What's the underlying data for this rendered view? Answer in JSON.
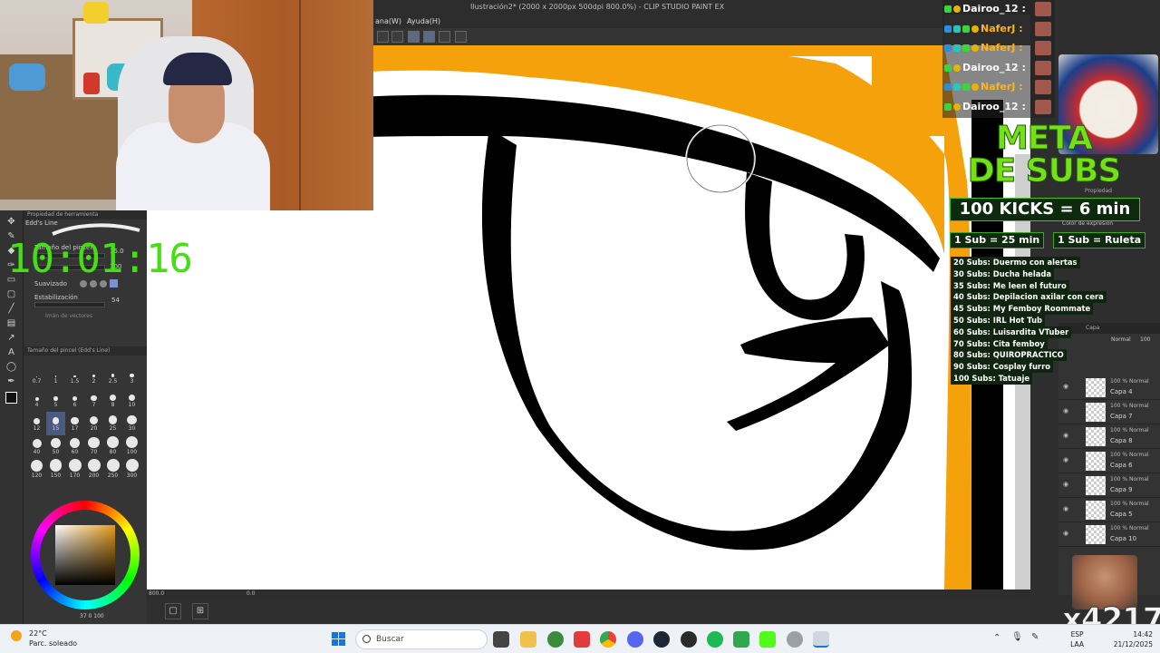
{
  "window": {
    "title": "Ilustración2* (2000 x 2000px 500dpi 800.0%) - CLIP STUDIO PAINT EX",
    "menu": [
      "ana(W)",
      "Ayuda(H)"
    ]
  },
  "stream": {
    "timer": "10:01:16",
    "chat": [
      {
        "user": "Dairoo_12 :",
        "color": "#ffffff"
      },
      {
        "user": "NaferJ :",
        "color": "#ffb31a"
      },
      {
        "user": "NaferJ :",
        "color": "#ffb31a"
      },
      {
        "user": "Dairoo_12 :",
        "color": "#ffffff"
      },
      {
        "user": "NaferJ :",
        "color": "#ffb31a"
      },
      {
        "user": "Dairoo_12 :",
        "color": "#ffffff"
      }
    ],
    "goal": {
      "title_line1": "META",
      "title_line2": "DE SUBS",
      "kicks": "100 KICKS = 6 min",
      "chip1": "1 Sub = 25 min",
      "chip2": "1 Sub = Ruleta",
      "items": [
        "20 Subs: Duermo con alertas",
        "30 Subs: Ducha helada",
        "35 Subs: Me leen el futuro",
        "40 Subs: Depilacion axilar con cera",
        "45 Subs: My Femboy Roommate",
        "50 Subs: IRL Hot Tub",
        "60 Subs: Luisardita VTuber",
        "70 Subs: Cita femboy",
        "80 Subs: QUIROPRACTICO",
        "90 Subs: Cosplay furro",
        "100 Subs: Tatuaje"
      ]
    },
    "bits": "x4217"
  },
  "tool_panel": {
    "brush_name": "Edd's Line",
    "size_label": "Tamaño del pincel",
    "size_value": "15.0",
    "opacity_value": "100",
    "smooth_label": "Suavizado",
    "stab_label": "Estabilización",
    "stab_value": "54",
    "vector_label": "Imán de vectores",
    "size_header": "Tamaño del pincel (Edd's Line)",
    "sizes": [
      "0.7",
      "1",
      "1.5",
      "2",
      "2.5",
      "3",
      "4",
      "5",
      "6",
      "7",
      "8",
      "10",
      "12",
      "15",
      "17",
      "20",
      "25",
      "30",
      "40",
      "50",
      "60",
      "70",
      "80",
      "100",
      "120",
      "150",
      "170",
      "200",
      "250",
      "300"
    ],
    "color_values": "37 0 100"
  },
  "canvas": {
    "zoom": "800.0",
    "rotation": "0.0"
  },
  "layers": {
    "header": "Capa",
    "opacity": "100",
    "mode_label": "Normal",
    "rows": [
      {
        "mode": "100 % Normal",
        "name": "Capa 4"
      },
      {
        "mode": "100 % Normal",
        "name": "Capa 7"
      },
      {
        "mode": "100 % Normal",
        "name": "Capa 8"
      },
      {
        "mode": "100 % Normal",
        "name": "Capa 6"
      },
      {
        "mode": "100 % Normal",
        "name": "Capa 9"
      },
      {
        "mode": "100 % Normal",
        "name": "Capa 5"
      },
      {
        "mode": "100 % Normal",
        "name": "Capa 10"
      }
    ]
  },
  "right_labels": {
    "properties": "Propiedad",
    "color_expr": "Color de expresión"
  },
  "taskbar": {
    "temp": "22°C",
    "weather": "Parc. soleado",
    "search": "Buscar",
    "lang1": "ESP",
    "lang2": "LAA",
    "time": "14:42",
    "date": "21/12/2025"
  },
  "colors": {
    "accent_green": "#45e012",
    "canvas_orange": "#f5a10c",
    "chat_orange": "#ffb31a"
  }
}
